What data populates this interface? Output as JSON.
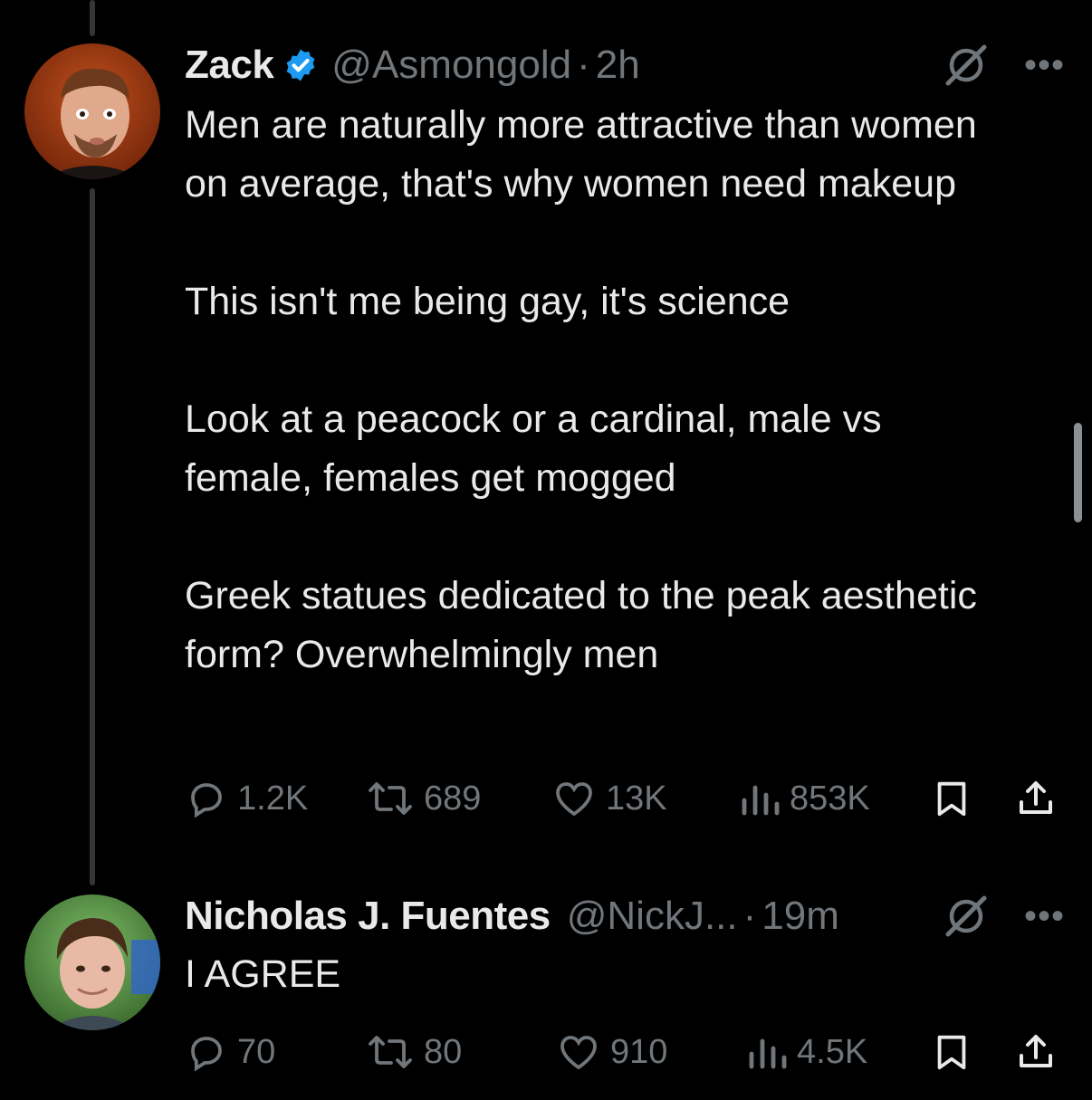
{
  "tweets": [
    {
      "name": "Zack",
      "verified": true,
      "handle": "@Asmongold",
      "time": "2h",
      "paragraphs": [
        "Men are naturally more attractive than women on average, that's why women need makeup",
        "This isn't me being gay, it's science",
        "Look at a peacock or a cardinal, male vs female, females get mogged",
        "Greek statues dedicated to the peak aesthetic form? Overwhelmingly men"
      ],
      "stats": {
        "replies": "1.2K",
        "reposts": "689",
        "likes": "13K",
        "views": "853K"
      }
    },
    {
      "name": "Nicholas J. Fuentes",
      "verified": false,
      "handle": "@NickJ...",
      "time": "19m",
      "paragraphs": [
        "I AGREE"
      ],
      "stats": {
        "replies": "70",
        "reposts": "80",
        "likes": "910",
        "views": "4.5K"
      }
    }
  ],
  "colors": {
    "background": "#000000",
    "text": "#e7e9ea",
    "muted": "#71767b",
    "verified": "#1d9bf0"
  },
  "icons": [
    "verified-badge-icon",
    "grok-icon",
    "more-icon",
    "reply-icon",
    "repost-icon",
    "like-icon",
    "views-icon",
    "bookmark-icon",
    "share-icon"
  ]
}
